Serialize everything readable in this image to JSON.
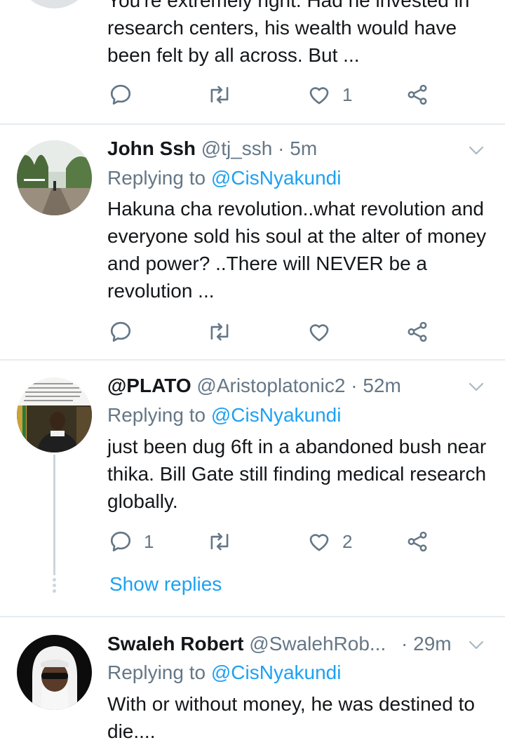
{
  "tweets": [
    {
      "body": "You're extremely right. Had he invested in research centers, his wealth would have been felt by all across. But ...",
      "reply_count": "",
      "like_count": "1"
    },
    {
      "name": "John Ssh",
      "handle": "@tj_ssh",
      "dot": "·",
      "time": "5m",
      "replying_prefix": "Replying to",
      "replying_to": "@CisNyakundi",
      "body": "Hakuna cha revolution..what revolution and everyone sold his soul at the alter of money and power? ..There will NEVER be a revolution ...",
      "reply_count": "",
      "like_count": ""
    },
    {
      "name": "@PLATO",
      "handle": "@Aristoplatonic2",
      "dot": "·",
      "time": "52m",
      "replying_prefix": "Replying to",
      "replying_to": "@CisNyakundi",
      "body": "just been dug 6ft in a abandoned bush near thika. Bill Gate still finding medical research globally.",
      "reply_count": "1",
      "like_count": "2",
      "show_replies": "Show replies"
    },
    {
      "name": "Swaleh Robert",
      "handle": "@SwalehRob...",
      "dot": "·",
      "time": "29m",
      "replying_prefix": "Replying to",
      "replying_to": "@CisNyakundi",
      "body": "With or without money, he was destined to die...."
    }
  ],
  "icons": {
    "reply": "comment-icon",
    "retweet": "retweet-icon",
    "like": "heart-icon",
    "share": "share-icon",
    "menu": "chevron-down-icon"
  },
  "colors": {
    "accent": "#1da1f2",
    "secondary_text": "#657786",
    "divider": "#e6ecf0"
  }
}
